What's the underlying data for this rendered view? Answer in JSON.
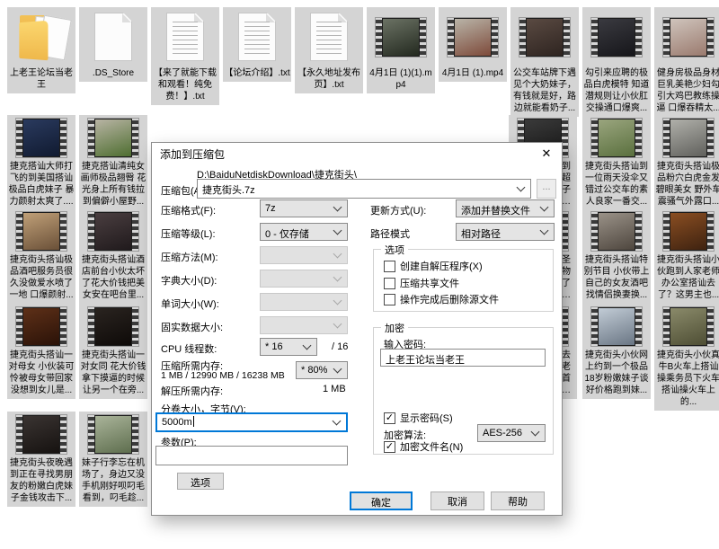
{
  "dialog": {
    "title": "添加到压缩包",
    "archive_label": "压缩包(A)",
    "archive_path": "D:\\BaiduNetdiskDownload\\捷克街头\\",
    "archive_name": "捷克街头.7z",
    "browse_label": "...",
    "close_glyph": "✕",
    "fields_left": [
      {
        "label": "压缩格式(F):",
        "value": "7z",
        "disabled": false
      },
      {
        "label": "压缩等级(L):",
        "value": "0 - 仅存储",
        "disabled": false
      },
      {
        "label": "压缩方法(M):",
        "value": "",
        "disabled": true
      },
      {
        "label": "字典大小(D):",
        "value": "",
        "disabled": true
      },
      {
        "label": "单词大小(W):",
        "value": "",
        "disabled": true
      },
      {
        "label": "固实数据大小:",
        "value": "",
        "disabled": true
      }
    ],
    "fields_right": [
      {
        "label": "更新方式(U):",
        "value": "添加并替换文件"
      },
      {
        "label": "路径模式",
        "value": "相对路径"
      }
    ],
    "cpu": {
      "label": "CPU 线程数:",
      "value": "* 16",
      "suffix": "/ 16"
    },
    "mem_compress": {
      "label": "压缩所需内存:",
      "value": "1 MB / 12990 MB / 16238 MB",
      "combo": "* 80%"
    },
    "mem_decompress": {
      "label": "解压所需内存:",
      "value": "1 MB"
    },
    "volume": {
      "label": "分卷大小，字节(V):",
      "value": "5000m"
    },
    "params": {
      "label": "参数(P):",
      "value": ""
    },
    "options_group": {
      "title": "选项",
      "checkboxes": [
        {
          "label": "创建自解压程序(X)",
          "checked": false
        },
        {
          "label": "压缩共享文件",
          "checked": false
        },
        {
          "label": "操作完成后删除源文件",
          "checked": false
        }
      ]
    },
    "encrypt_group": {
      "title": "加密",
      "password_label": "输入密码:",
      "password": "上老王论坛当老王",
      "show_password": {
        "label": "显示密码(S)",
        "checked": true
      },
      "algo_label": "加密算法:",
      "algo": "AES-256",
      "encrypt_names": {
        "label": "加密文件名(N)",
        "checked": true
      }
    },
    "options_button": "选项",
    "buttons": {
      "ok": "确定",
      "cancel": "取消",
      "help": "帮助"
    },
    "accent": "#0078d7"
  },
  "files": {
    "top_row": [
      {
        "type": "folder",
        "name": "上老王论坛当老王"
      },
      {
        "type": "page",
        "name": ".DS_Store"
      },
      {
        "type": "doc",
        "name": "【来了就能下载和观看！纯免费！】.txt"
      },
      {
        "type": "doc",
        "name": "【论坛介绍】.txt"
      },
      {
        "type": "doc",
        "name": "【永久地址发布页】.txt"
      },
      {
        "type": "video",
        "name": "4月1日 (1)(1).mp4",
        "colors": [
          "#6b7264",
          "#23291f"
        ]
      },
      {
        "type": "video",
        "name": "4月1日 (1).mp4",
        "colors": [
          "#b9b4a8",
          "#7d4a3a"
        ]
      },
      {
        "type": "video",
        "name": "公交车站牌下遇见个大奶妹子，有钱就是好，路边就能看奶子...",
        "colors": [
          "#5a4a42",
          "#2e2420"
        ]
      },
      {
        "type": "video",
        "name": "勾引来应聘的极品白虎模特 知道潜规则让小伙肛交操通口爆爽...",
        "colors": [
          "#3a3a40",
          "#16161a"
        ]
      },
      {
        "type": "video",
        "name": "健身房极品身材巨乳美艳少妇勾引大鸡巴教练操逼 口爆吞精太...",
        "colors": [
          "#cfc4bc",
          "#9a7a6e"
        ]
      }
    ],
    "left_grid": [
      {
        "type": "video",
        "name": "捷克搭讪大师打飞的到美国搭讪极品白虎妹子 暴力颜射太爽了....",
        "colors": [
          "#2a3a5e",
          "#101a30"
        ]
      },
      {
        "type": "video",
        "name": "捷克搭讪清纯女画师极品翘臀 花光身上所有钱拉到偏僻小屋野...",
        "colors": [
          "#b8b4a4",
          "#4e6e30"
        ]
      },
      {
        "type": "video",
        "name": "捷克街头搭讪极品酒吧服务员很久没做爱水喷了一地 口爆颜射...",
        "colors": [
          "#c0a078",
          "#6a5038"
        ]
      },
      {
        "type": "video",
        "name": "捷克街头搭讪酒店前台小伙太坏了花大价钱把美女安在吧台里...",
        "colors": [
          "#4a3e40",
          "#201a1c"
        ]
      },
      {
        "type": "video",
        "name": "捷克街头搭讪一对母女 小伙装可怜被母女带回家没想到女儿是...",
        "colors": [
          "#5e3018",
          "#2a1208"
        ]
      },
      {
        "type": "video",
        "name": "捷克街头搭讪一对女同 花大价钱拿下摸逼的时候让另一个在旁...",
        "colors": [
          "#2a2420",
          "#0e0a08"
        ]
      },
      {
        "type": "video",
        "name": "捷克街头夜晚遇到正在寻找男朋友的粉嫩白虎妹子金钱攻击下...",
        "colors": [
          "#3a3432",
          "#161210"
        ]
      },
      {
        "type": "video",
        "name": "妹子行李忘在机场了，身边又没手机刚好呗叼毛看到，叼毛趁...",
        "colors": [
          "#aab49a",
          "#5e6e4e"
        ]
      }
    ],
    "right_grid": [
      {
        "type": "video",
        "name": "捷克街头搭讪到一位雨天没伞又错过公交车的素人良家一番交...",
        "colors": [
          "#9aa57e",
          "#5a703e"
        ]
      },
      {
        "type": "video",
        "name": "捷克街头搭讪极品粉穴白虎金发碧眼美女 野外车震骚气外露口...",
        "colors": [
          "#b0b0aa",
          "#60605c"
        ]
      },
      {
        "type": "video",
        "name": "捷克街头搭讪特别节目 小伙带上自己的女友酒吧找情侣换妻换...",
        "colors": [
          "#9a9288",
          "#4e463e"
        ]
      },
      {
        "type": "video",
        "name": "捷克街头搭讪小伙跑到人家老师办公室搭讪去了？这男主也...",
        "colors": [
          "#8a4e22",
          "#3e2210"
        ]
      },
      {
        "type": "video",
        "name": "捷克街头小伙网上约到一个极品18岁粉嫩妹子谈好价格跑到妹...",
        "colors": [
          "#c2ccd6",
          "#6a7684"
        ]
      },
      {
        "type": "video",
        "name": "捷克街头小伙真牛B火车上搭讪操乘务员下火车搭讪操火车上的...",
        "colors": [
          "#8a8a6a",
          "#4e4e34"
        ]
      }
    ],
    "hidden_fragments": [
      {
        "lines": [
          "到",
          "超",
          "子",
          "…"
        ],
        "colors": [
          "#3a3a3a",
          "#181818"
        ]
      },
      {
        "lines": [
          "圣",
          "物",
          "了",
          "…"
        ],
        "colors": [
          "#3a3a3a",
          "#181818"
        ]
      },
      {
        "lines": [
          "去",
          "老",
          "首",
          "…"
        ],
        "colors": [
          "#3a3a3a",
          "#181818"
        ]
      }
    ]
  }
}
